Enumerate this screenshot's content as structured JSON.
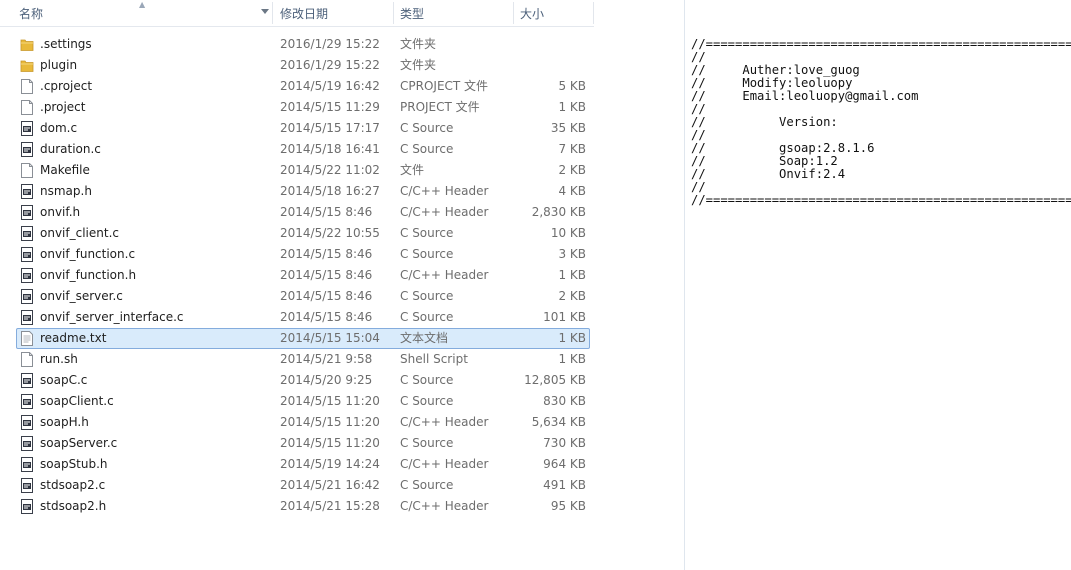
{
  "columns": {
    "name": "名称",
    "date": "修改日期",
    "type": "类型",
    "size": "大小"
  },
  "files": [
    {
      "name": ".settings",
      "date": "2016/1/29 15:22",
      "type": "文件夹",
      "size": "",
      "icon": "folder-icon"
    },
    {
      "name": "plugin",
      "date": "2016/1/29 15:22",
      "type": "文件夹",
      "size": "",
      "icon": "folder-icon"
    },
    {
      "name": ".cproject",
      "date": "2014/5/19 16:42",
      "type": "CPROJECT 文件",
      "size": "5 KB",
      "icon": "blank-file-icon"
    },
    {
      "name": ".project",
      "date": "2014/5/15 11:29",
      "type": "PROJECT 文件",
      "size": "1 KB",
      "icon": "blank-file-icon"
    },
    {
      "name": "dom.c",
      "date": "2014/5/15 17:17",
      "type": "C Source",
      "size": "35 KB",
      "icon": "source-file-icon"
    },
    {
      "name": "duration.c",
      "date": "2014/5/18 16:41",
      "type": "C Source",
      "size": "7 KB",
      "icon": "source-file-icon"
    },
    {
      "name": "Makefile",
      "date": "2014/5/22 11:02",
      "type": "文件",
      "size": "2 KB",
      "icon": "blank-file-icon"
    },
    {
      "name": "nsmap.h",
      "date": "2014/5/18 16:27",
      "type": "C/C++ Header",
      "size": "4 KB",
      "icon": "source-file-icon"
    },
    {
      "name": "onvif.h",
      "date": "2014/5/15 8:46",
      "type": "C/C++ Header",
      "size": "2,830 KB",
      "icon": "source-file-icon"
    },
    {
      "name": "onvif_client.c",
      "date": "2014/5/22 10:55",
      "type": "C Source",
      "size": "10 KB",
      "icon": "source-file-icon"
    },
    {
      "name": "onvif_function.c",
      "date": "2014/5/15 8:46",
      "type": "C Source",
      "size": "3 KB",
      "icon": "source-file-icon"
    },
    {
      "name": "onvif_function.h",
      "date": "2014/5/15 8:46",
      "type": "C/C++ Header",
      "size": "1 KB",
      "icon": "source-file-icon"
    },
    {
      "name": "onvif_server.c",
      "date": "2014/5/15 8:46",
      "type": "C Source",
      "size": "2 KB",
      "icon": "source-file-icon"
    },
    {
      "name": "onvif_server_interface.c",
      "date": "2014/5/15 8:46",
      "type": "C Source",
      "size": "101 KB",
      "icon": "source-file-icon"
    },
    {
      "name": "readme.txt",
      "date": "2014/5/15 15:04",
      "type": "文本文档",
      "size": "1 KB",
      "icon": "text-file-icon",
      "selected": true
    },
    {
      "name": "run.sh",
      "date": "2014/5/21 9:58",
      "type": "Shell Script",
      "size": "1 KB",
      "icon": "blank-file-icon"
    },
    {
      "name": "soapC.c",
      "date": "2014/5/20 9:25",
      "type": "C Source",
      "size": "12,805 KB",
      "icon": "source-file-icon"
    },
    {
      "name": "soapClient.c",
      "date": "2014/5/15 11:20",
      "type": "C Source",
      "size": "830 KB",
      "icon": "source-file-icon"
    },
    {
      "name": "soapH.h",
      "date": "2014/5/15 11:20",
      "type": "C/C++ Header",
      "size": "5,634 KB",
      "icon": "source-file-icon"
    },
    {
      "name": "soapServer.c",
      "date": "2014/5/15 11:20",
      "type": "C Source",
      "size": "730 KB",
      "icon": "source-file-icon"
    },
    {
      "name": "soapStub.h",
      "date": "2014/5/19 14:24",
      "type": "C/C++ Header",
      "size": "964 KB",
      "icon": "source-file-icon"
    },
    {
      "name": "stdsoap2.c",
      "date": "2014/5/21 16:42",
      "type": "C Source",
      "size": "491 KB",
      "icon": "source-file-icon"
    },
    {
      "name": "stdsoap2.h",
      "date": "2014/5/21 15:28",
      "type": "C/C++ Header",
      "size": "95 KB",
      "icon": "source-file-icon"
    }
  ],
  "preview": {
    "lines": [
      "//=====================================================",
      "//",
      "//     Auther:love_guog",
      "//     Modify:leoluopy",
      "//     Email:leoluopy@gmail.com",
      "//",
      "//          Version:",
      "//",
      "//          gsoap:2.8.1.6",
      "//          Soap:1.2",
      "//          Onvif:2.4",
      "//",
      "//====================================================="
    ]
  },
  "colors": {
    "folder": "#e8b93a",
    "selection": "#d9ebfb",
    "selection_border": "#84acdd",
    "header_text": "#4c607a"
  }
}
